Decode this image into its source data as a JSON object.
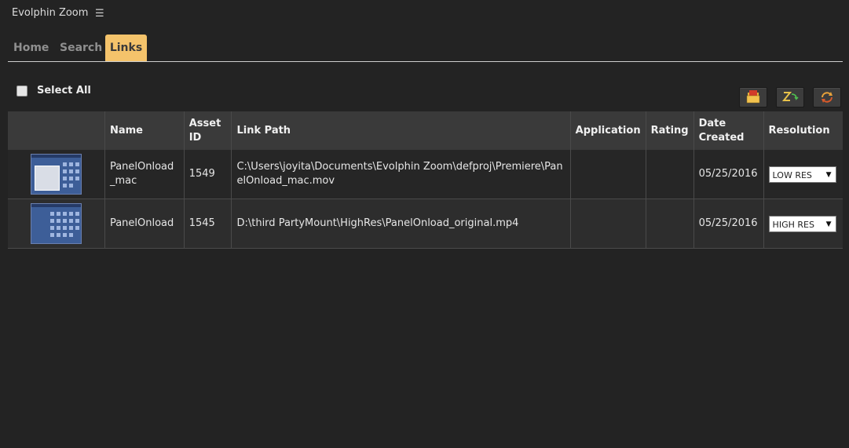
{
  "app": {
    "title": "Evolphin Zoom",
    "menu_icon": "hamburger-icon"
  },
  "tabs": [
    {
      "label": "Home",
      "active": false
    },
    {
      "label": "Search",
      "active": false
    },
    {
      "label": "Links",
      "active": true
    }
  ],
  "select_all": {
    "label": "Select All",
    "checked": false
  },
  "toolbar": {
    "buttons": [
      {
        "icon": "open-folder-icon"
      },
      {
        "icon": "zoom-sync-icon"
      },
      {
        "icon": "refresh-icon"
      }
    ]
  },
  "table": {
    "headers": [
      "",
      "Name",
      "Asset ID",
      "Link Path",
      "Application",
      "Rating",
      "Date Created",
      "Resolution"
    ],
    "rows": [
      {
        "name": "PanelOnload_mac",
        "asset_id": "1549",
        "link_path": "C:\\Users\\joyita\\Documents\\Evolphin Zoom\\defproj\\Premiere\\PanelOnload_mac.mov",
        "application": "",
        "rating": "",
        "date_created": "05/25/2016",
        "resolution": "LOW RES"
      },
      {
        "name": "PanelOnload",
        "asset_id": "1545",
        "link_path": "D:\\third PartyMount\\HighRes\\PanelOnload_original.mp4",
        "application": "",
        "rating": "",
        "date_created": "05/25/2016",
        "resolution": "HIGH RES"
      }
    ]
  },
  "colors": {
    "accent_tab": "#f4c36b",
    "background": "#232323",
    "header_bg": "#3a3a3a"
  }
}
